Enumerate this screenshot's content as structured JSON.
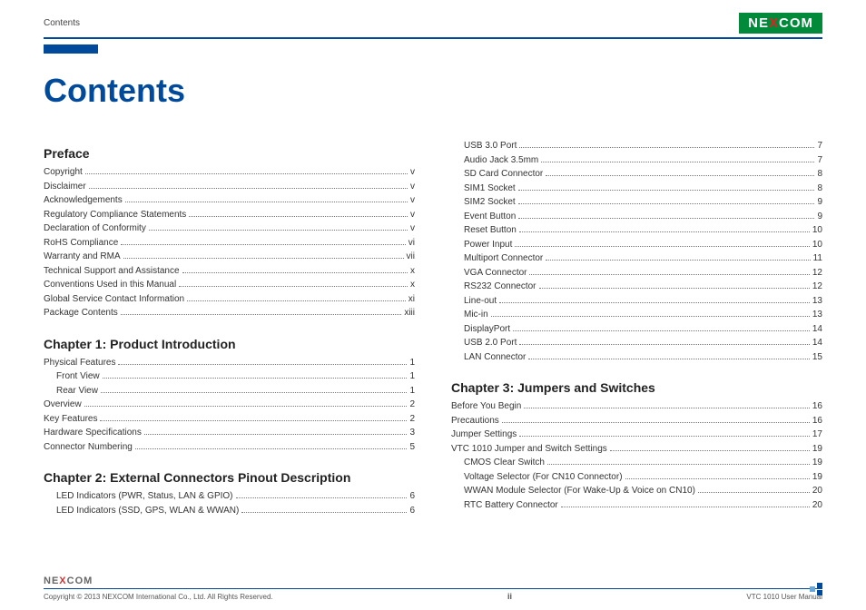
{
  "header": {
    "breadcrumb": "Contents",
    "logo_text_pre": "NE",
    "logo_text_x": "X",
    "logo_text_post": "COM"
  },
  "title": "Contents",
  "columns": [
    [
      {
        "type": "heading",
        "text": "Preface"
      },
      {
        "type": "item",
        "label": "Copyright",
        "page": "v",
        "indent": 0
      },
      {
        "type": "item",
        "label": "Disclaimer",
        "page": "v",
        "indent": 0
      },
      {
        "type": "item",
        "label": "Acknowledgements",
        "page": "v",
        "indent": 0
      },
      {
        "type": "item",
        "label": "Regulatory Compliance Statements",
        "page": "v",
        "indent": 0
      },
      {
        "type": "item",
        "label": "Declaration of Conformity",
        "page": "v",
        "indent": 0
      },
      {
        "type": "item",
        "label": "RoHS Compliance",
        "page": "vi",
        "indent": 0
      },
      {
        "type": "item",
        "label": "Warranty and RMA",
        "page": "vii",
        "indent": 0
      },
      {
        "type": "item",
        "label": "Technical Support and Assistance",
        "page": "x",
        "indent": 0
      },
      {
        "type": "item",
        "label": "Conventions Used in this Manual",
        "page": "x",
        "indent": 0
      },
      {
        "type": "item",
        "label": "Global Service Contact Information",
        "page": "xi",
        "indent": 0
      },
      {
        "type": "item",
        "label": "Package Contents",
        "page": "xiii",
        "indent": 0
      },
      {
        "type": "spacer"
      },
      {
        "type": "heading",
        "text": "Chapter 1: Product Introduction"
      },
      {
        "type": "item",
        "label": "Physical Features",
        "page": "1",
        "indent": 0
      },
      {
        "type": "item",
        "label": "Front View",
        "page": "1",
        "indent": 1
      },
      {
        "type": "item",
        "label": "Rear View",
        "page": "1",
        "indent": 1
      },
      {
        "type": "item",
        "label": "Overview",
        "page": "2",
        "indent": 0
      },
      {
        "type": "item",
        "label": "Key Features",
        "page": "2",
        "indent": 0
      },
      {
        "type": "item",
        "label": "Hardware Specifications",
        "page": "3",
        "indent": 0
      },
      {
        "type": "item",
        "label": "Connector Numbering",
        "page": "5",
        "indent": 0
      },
      {
        "type": "spacer"
      },
      {
        "type": "heading",
        "text": "Chapter 2: External Connectors Pinout Description"
      },
      {
        "type": "item",
        "label": "LED Indicators (PWR, Status, LAN & GPIO)",
        "page": "6",
        "indent": 1
      },
      {
        "type": "item",
        "label": "LED Indicators (SSD, GPS, WLAN & WWAN)",
        "page": "6",
        "indent": 1
      }
    ],
    [
      {
        "type": "item",
        "label": "USB 3.0 Port",
        "page": "7",
        "indent": 1
      },
      {
        "type": "item",
        "label": "Audio Jack 3.5mm",
        "page": "7",
        "indent": 1
      },
      {
        "type": "item",
        "label": "SD Card Connector",
        "page": "8",
        "indent": 1
      },
      {
        "type": "item",
        "label": "SIM1 Socket",
        "page": "8",
        "indent": 1
      },
      {
        "type": "item",
        "label": "SIM2 Socket",
        "page": "9",
        "indent": 1
      },
      {
        "type": "item",
        "label": "Event Button",
        "page": "9",
        "indent": 1
      },
      {
        "type": "item",
        "label": "Reset Button",
        "page": "10",
        "indent": 1
      },
      {
        "type": "item",
        "label": "Power Input",
        "page": "10",
        "indent": 1
      },
      {
        "type": "item",
        "label": "Multiport Connector",
        "page": "11",
        "indent": 1
      },
      {
        "type": "item",
        "label": "VGA Connector",
        "page": "12",
        "indent": 1
      },
      {
        "type": "item",
        "label": "RS232 Connector",
        "page": "12",
        "indent": 1
      },
      {
        "type": "item",
        "label": "Line-out",
        "page": "13",
        "indent": 1
      },
      {
        "type": "item",
        "label": "Mic-in",
        "page": "13",
        "indent": 1
      },
      {
        "type": "item",
        "label": "DisplayPort",
        "page": "14",
        "indent": 1
      },
      {
        "type": "item",
        "label": "USB 2.0 Port",
        "page": "14",
        "indent": 1
      },
      {
        "type": "item",
        "label": "LAN Connector",
        "page": "15",
        "indent": 1
      },
      {
        "type": "spacer"
      },
      {
        "type": "heading",
        "text": "Chapter 3: Jumpers and Switches"
      },
      {
        "type": "item",
        "label": "Before You Begin",
        "page": "16",
        "indent": 0
      },
      {
        "type": "item",
        "label": "Precautions",
        "page": "16",
        "indent": 0
      },
      {
        "type": "item",
        "label": "Jumper Settings",
        "page": "17",
        "indent": 0
      },
      {
        "type": "item",
        "label": "VTC 1010 Jumper and Switch Settings",
        "page": "19",
        "indent": 0
      },
      {
        "type": "item",
        "label": "CMOS Clear Switch",
        "page": "19",
        "indent": 1
      },
      {
        "type": "item",
        "label": "Voltage Selector (For CN10 Connector)",
        "page": "19",
        "indent": 1
      },
      {
        "type": "item",
        "label": "WWAN Module Selector (For Wake-Up & Voice on CN10)",
        "page": "20",
        "indent": 1
      },
      {
        "type": "item",
        "label": "RTC Battery Connector",
        "page": "20",
        "indent": 1
      }
    ]
  ],
  "footer": {
    "logo_pre": "NE",
    "logo_x": "X",
    "logo_post": "COM",
    "copyright": "Copyright © 2013 NEXCOM International Co., Ltd. All Rights Reserved.",
    "page_num": "ii",
    "manual": "VTC 1010 User Manual"
  }
}
